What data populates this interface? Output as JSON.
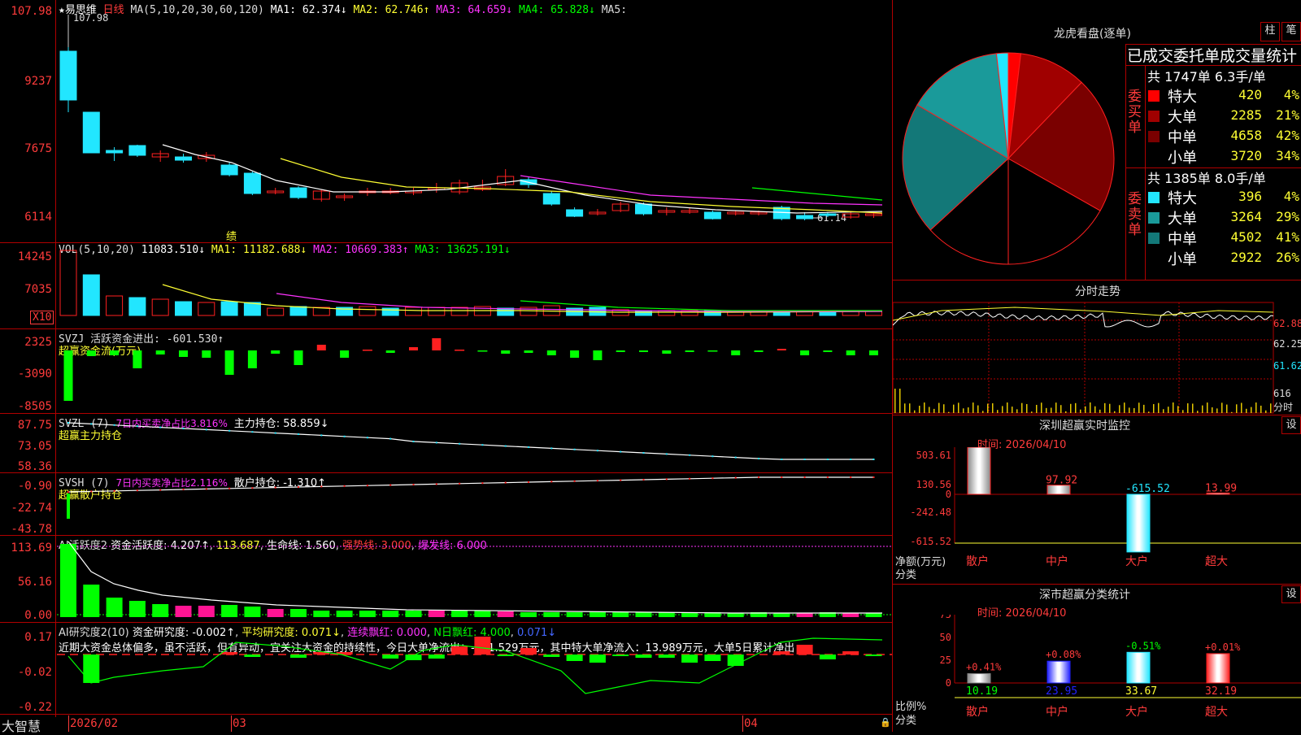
{
  "colors": {
    "up": "#ff2020",
    "down": "#22e6ff",
    "green": "#00ff00",
    "yellow": "#ffff33",
    "magenta": "#ff33ff",
    "grid": "#b00000"
  },
  "main": {
    "stock_name": "易思维",
    "period": "日线",
    "ma_title": "MA(5,10,20,30,60,120)",
    "ma1": "MA1: 62.374↓",
    "ma2": "MA2: 62.746↑",
    "ma3": "MA3: 64.659↓",
    "ma4": "MA4: 65.828↓",
    "ma5": "MA5:",
    "high_note": "107.98",
    "low_note": "61.14",
    "marker": "绩",
    "y": [
      "107.98",
      "9237",
      "7675",
      "6114"
    ]
  },
  "vol": {
    "title": "VOL(5,10,20)",
    "value": "11083.510↓",
    "ma1": "MA1: 11182.688↓",
    "ma2": "MA2: 10669.383↑",
    "ma3": "MA3: 13625.191↓",
    "y": [
      "14245",
      "7035"
    ],
    "x10": "X10"
  },
  "svzj": {
    "title": "SVZJ  活跃资金进出: -601.530↑",
    "sub": "超赢资金流(万元)",
    "y": [
      "2325",
      "-3090",
      "-8505"
    ]
  },
  "svzl": {
    "title": "SVZL (7)",
    "p1": "7日内买卖净占比3.816%",
    "p2": "主力持仓: 58.859↓",
    "sub": "超赢主力持仓",
    "y": [
      "87.75",
      "73.05",
      "58.36"
    ]
  },
  "svsh": {
    "title": "SVSH (7)",
    "p1": "7日内买卖净占比2.116%",
    "p2": "散户持仓: -1.310↑",
    "sub": "超赢散户持仓",
    "y": [
      "-0.90",
      "-22.74",
      "-43.78"
    ]
  },
  "ai1": {
    "title": "AI活跃度2",
    "p1": "资金活跃度: 4.207↑",
    "p2": "113.687",
    "p3": "生命线: 1.560",
    "p4": "强势线: 3.000",
    "p5": "爆发线: 6.000",
    "y": [
      "113.69",
      "56.16",
      "0.00"
    ]
  },
  "ai2": {
    "title": "AI研究度2(10)",
    "p1": "资金研究度: -0.002↑",
    "p2": "平均研究度: 0.071↓",
    "p3": "连续飘红: 0.000",
    "p4": "N日飘红: 4.000",
    "p5": "0.071↓",
    "y": [
      "0.17",
      "-0.02",
      "-0.22"
    ],
    "comment": "近期大资金总体偏多，虽不活跃，但有异动，宜关注大资金的持续性，今日大单净流出：-601.529万元，其中特大单净流入：13.989万元，大单5日累计净出"
  },
  "xaxis": {
    "m1": "2026/02",
    "m2": "03",
    "m3": "04",
    "brand": "大智慧"
  },
  "lhb": {
    "title": "龙虎看盘(逐单)",
    "btn1": "柱",
    "btn2": "笔",
    "stat_title": "已成交委托单成交量统计",
    "buy_total": "共 1747单 6.3手/单",
    "sell_total": "共 1385单 8.0手/单",
    "buy_label": "委买单",
    "sell_label": "委卖单",
    "buy": [
      {
        "name": "特大",
        "val": "420",
        "pct": "4%",
        "color": "#ff0000"
      },
      {
        "name": "大单",
        "val": "2285",
        "pct": "21%",
        "color": "#a00000"
      },
      {
        "name": "中单",
        "val": "4658",
        "pct": "42%",
        "color": "#7a0000"
      },
      {
        "name": "小单",
        "val": "3720",
        "pct": "34%",
        "color": "#000000"
      }
    ],
    "sell": [
      {
        "name": "特大",
        "val": "396",
        "pct": "4%",
        "color": "#22e6ff"
      },
      {
        "name": "大单",
        "val": "3264",
        "pct": "29%",
        "color": "#1a9a9a"
      },
      {
        "name": "中单",
        "val": "4502",
        "pct": "41%",
        "color": "#137878"
      },
      {
        "name": "小单",
        "val": "2922",
        "pct": "26%",
        "color": "#000000"
      }
    ]
  },
  "fenshi": {
    "title": "分时走势",
    "y": [
      "62.88",
      "62.25",
      "61.62",
      "616",
      "分时"
    ]
  },
  "monitor": {
    "title": "深圳超赢实时监控",
    "btn": "设",
    "time": "时间: 2026/04/10",
    "ylabel1": "净额(万元)",
    "ylabel2": "分类",
    "y": [
      "503.61",
      "130.56",
      "0",
      "-242.48",
      "-615.52"
    ],
    "bars": [
      {
        "cat": "散户",
        "val": 503.61,
        "label": "503.61"
      },
      {
        "cat": "中户",
        "val": 97.92,
        "label": "97.92"
      },
      {
        "cat": "大户",
        "val": -615.52,
        "label": "-615.52"
      },
      {
        "cat": "超大",
        "val": 13.99,
        "label": "13.99"
      }
    ]
  },
  "classify": {
    "title": "深市超赢分类统计",
    "btn": "设",
    "time": "时间: 2026/04/10",
    "ylabel1": "比例%",
    "ylabel2": "分类",
    "y": [
      "75",
      "50",
      "25",
      "0"
    ],
    "bars": [
      {
        "cat": "散户",
        "val": 10.19,
        "label": "10.19",
        "chg": "+0.41%"
      },
      {
        "cat": "中户",
        "val": 23.95,
        "label": "23.95",
        "chg": "+0.08%"
      },
      {
        "cat": "大户",
        "val": 33.67,
        "label": "33.67",
        "chg": "-0.51%"
      },
      {
        "cat": "超大",
        "val": 32.19,
        "label": "32.19",
        "chg": "+0.01%"
      }
    ]
  }
}
